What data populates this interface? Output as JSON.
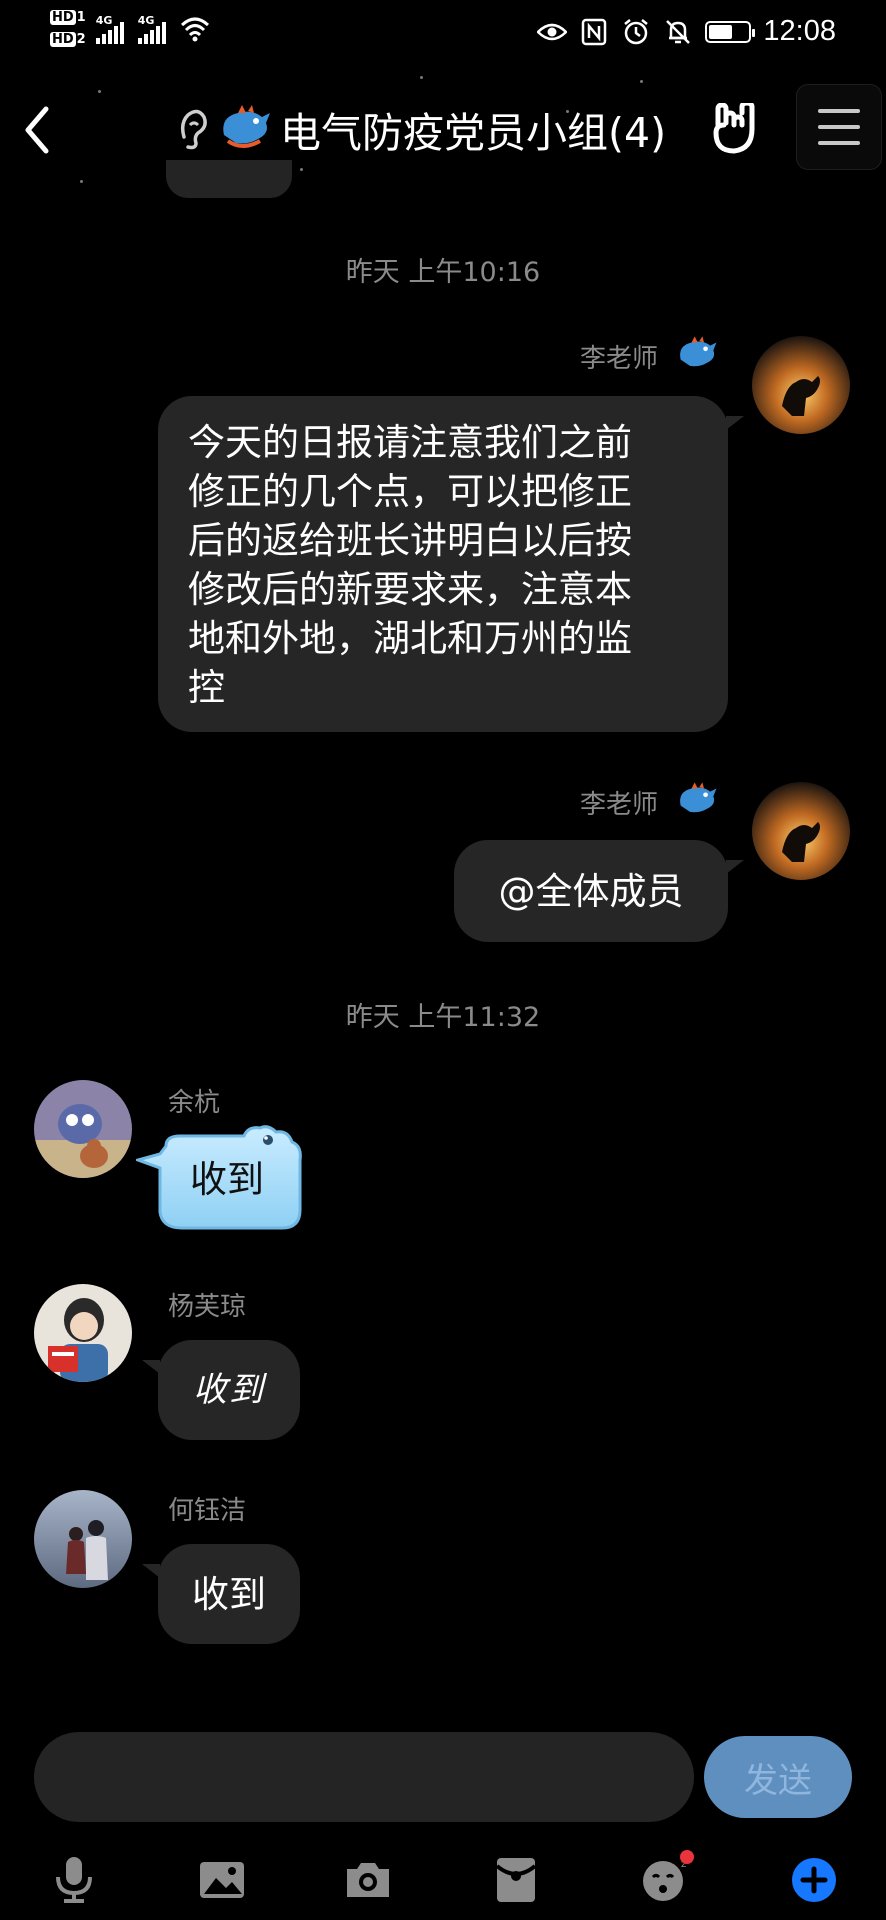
{
  "status_bar": {
    "hd1": "HD",
    "hd1_num": "1",
    "hd2": "HD",
    "hd2_num": "2",
    "net1": "4G",
    "net2": "4G",
    "time": "12:08",
    "battery_level": 0.6
  },
  "header": {
    "title": "电气防疫党员小组(4)"
  },
  "messages": [
    {
      "timestamp": "昨天 上午10:16",
      "sender": "李老师",
      "side": "right",
      "text_lines": [
        "今天的日报请注意我们之前",
        "修正的几个点，可以把修正",
        "后的返给班长讲明白以后按",
        "修改后的新要求来，注意本",
        "地和外地，湖北和万州的监",
        "控"
      ]
    },
    {
      "sender": "李老师",
      "side": "right",
      "text": "@全体成员"
    },
    {
      "timestamp": "昨天 上午11:32",
      "sender": "余杭",
      "side": "left",
      "text": "收到"
    },
    {
      "sender": "杨芙琼",
      "side": "left",
      "text": "收到"
    },
    {
      "sender": "何钰洁",
      "side": "left",
      "text": "收到"
    }
  ],
  "input": {
    "value": "",
    "send_label": "发送"
  },
  "toolbar": {
    "items": [
      "mic-icon",
      "image-icon",
      "camera-icon",
      "red-packet-icon",
      "emoji-icon",
      "plus-icon"
    ]
  },
  "colors": {
    "background": "#000000",
    "bubble": "#262626",
    "accent_blue": "#1677ff",
    "send_button": "#5f8fbf",
    "notification_dot": "#e8343a"
  }
}
